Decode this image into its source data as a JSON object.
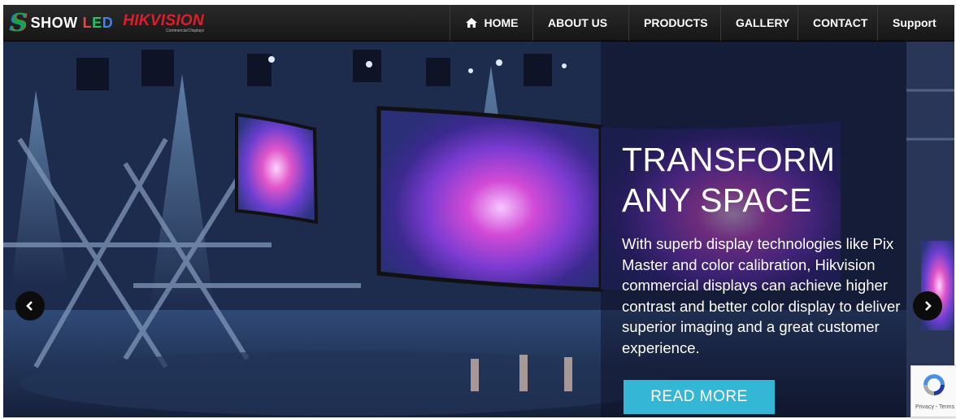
{
  "brand": {
    "mark": "S",
    "show": "SHOW",
    "led": [
      "L",
      "E",
      "D"
    ],
    "hikvision": "HIKVISION",
    "hikvision_sub": "Commercial Displays"
  },
  "nav": {
    "items": [
      {
        "label": "HOME",
        "icon": "home-icon"
      },
      {
        "label": "ABOUT US"
      },
      {
        "label": "PRODUCTS",
        "icon": "chevron-down-icon"
      },
      {
        "label": "GALLERY"
      },
      {
        "label": "CONTACT"
      },
      {
        "label": "Support"
      }
    ]
  },
  "hero": {
    "title_line1": "TRANSFORM",
    "title_line2": "ANY SPACE",
    "description": "With superb display technologies like Pix Master and color calibration, Hikvision commercial displays can achieve higher contrast and better color display to deliver superior imaging and a great customer experience.",
    "cta_label": "READ MORE",
    "prev_icon": "chevron-left-icon",
    "next_icon": "chevron-right-icon"
  },
  "recaptcha": {
    "links": "Privacy - Terms"
  },
  "colors": {
    "navbar": "#1e1e1e",
    "accent_button": "#33b7d4",
    "hikvision_red": "#e11d2a"
  }
}
